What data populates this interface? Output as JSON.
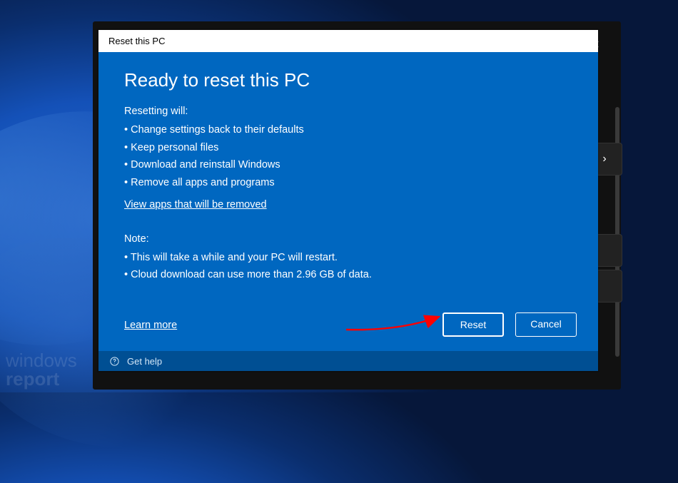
{
  "window": {
    "title": "Reset this PC",
    "close_label": "✕"
  },
  "body": {
    "heading": "Ready to reset this PC",
    "resetting_label": "Resetting will:",
    "resetting_items": [
      "Change settings back to their defaults",
      "Keep personal files",
      "Download and reinstall Windows",
      "Remove all apps and programs"
    ],
    "view_apps_link": "View apps that will be removed",
    "note_label": "Note:",
    "note_items": [
      "This will take a while and your PC will restart.",
      "Cloud download can use more than 2.96 GB of data."
    ],
    "learn_more_link": "Learn more"
  },
  "buttons": {
    "reset": "Reset",
    "cancel": "Cancel"
  },
  "footer": {
    "get_help": "Get help"
  },
  "watermark": {
    "line1": "windows",
    "line2": "report"
  },
  "background": {
    "chevron": "›"
  }
}
